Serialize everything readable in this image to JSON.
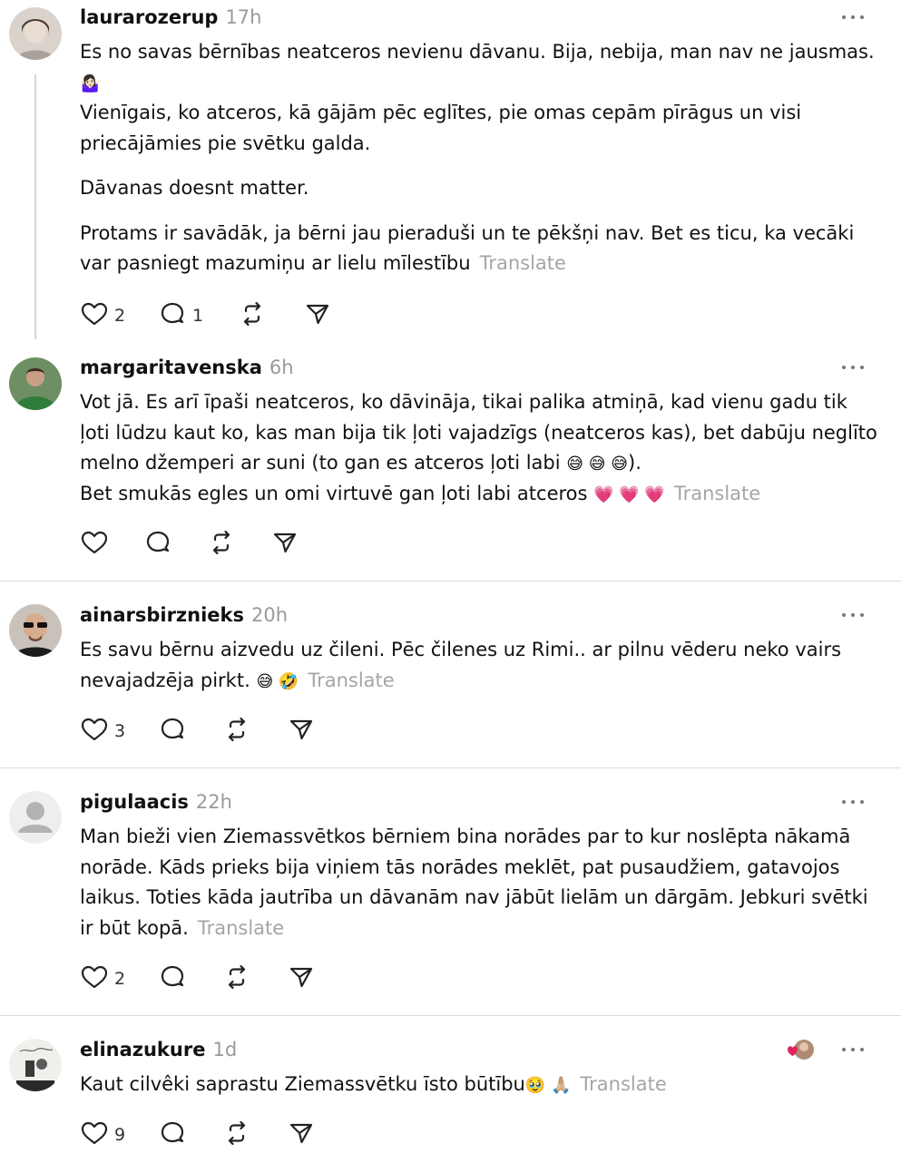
{
  "icons": {
    "like": "heart-icon",
    "reply": "comment-icon",
    "repost": "repost-icon",
    "share": "send-icon",
    "more": "more-icon"
  },
  "colors": {
    "text": "#111111",
    "meta": "#9a9a9a",
    "translate": "#a5a5a5",
    "divider": "#dcdcdc"
  },
  "posts": [
    {
      "username": "laurarozerup",
      "time": "17h",
      "paragraphs": [
        "Es no savas bērnības neatceros nevienu dāvanu. Bija, nebija, man nav ne jausmas.",
        "🤷🏻‍♀️",
        "Vienīgais, ko atceros, kā gājām pēc eglītes, pie omas cepām pīrāgus un visi priecājāmies pie svētku galda.",
        "Dāvanas doesnt matter.",
        "Protams ir savādāk, ja bērni jau pieraduši un te pēkšņi nav. Bet es ticu, ka vecāki var pasniegt mazumiņu ar lielu mīlestību"
      ],
      "translate": "Translate",
      "likes": "2",
      "replies": "1"
    },
    {
      "username": "margaritavenska",
      "time": "6h",
      "text_main": "Vot jā. Es arī īpaši neatceros, ko dāvināja, tikai palika atmiņā, kad vienu gadu tik ļoti lūdzu kaut ko, kas man bija tik ļoti vajadzīgs (neatceros kas), bet dabūju neglīto melno džemperi ar suni (to gan es atceros ļoti labi",
      "emoji_a": "😅 😅 😅",
      "text_close": ").",
      "text_second": "Bet smukās egles un omi virtuvē gan ļoti labi atceros",
      "emoji_b": "💗 💗 💗",
      "translate": "Translate"
    },
    {
      "username": "ainarsbirznieks",
      "time": "20h",
      "text": "Es savu bērnu aizvedu uz čileni. Pēc čilenes uz Rimi.. ar pilnu vēderu neko vairs nevajadzēja pirkt.",
      "emoji": "😅 🤣",
      "translate": "Translate",
      "likes": "3"
    },
    {
      "username": "pigulaacis",
      "time": "22h",
      "text": "Man bieži vien Ziemassvētkos bērniem bina norādes par to kur noslēpta nākamā norāde. Kāds prieks bija viņiem tās norādes meklēt, pat pusaudžiem, gatavojos laikus. Toties kāda jautrība un dāvanām nav jābūt lielām un dārgām. Jebkuri svētki ir būt kopā.",
      "translate": "Translate",
      "likes": "2"
    },
    {
      "username": "elinazukure",
      "time": "1d",
      "text": "Kaut cilvêki saprastu Ziemassvētku īsto būtību",
      "emoji": "🥹 🙏🏼",
      "translate": "Translate",
      "likes": "9"
    }
  ]
}
